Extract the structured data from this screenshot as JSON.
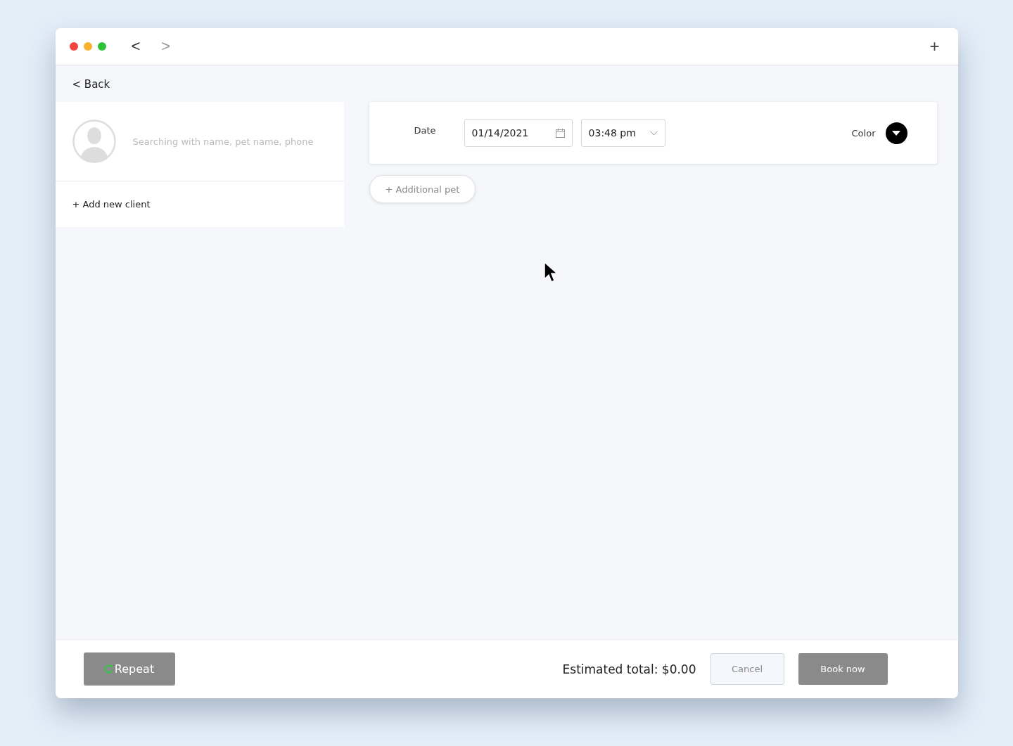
{
  "toolbar": {
    "back_arrow": "<",
    "forward_arrow": ">",
    "plus": "+"
  },
  "back_link": "< Back",
  "client": {
    "search_placeholder": "Searching with name, pet name, phone",
    "add_client": "+ Add new client"
  },
  "appointment": {
    "date_label": "Date",
    "date_value": "01/14/2021",
    "time_value": "03:48 pm",
    "color_label": "Color"
  },
  "additional_pet": "+ Additional pet",
  "footer": {
    "repeat": "Repeat",
    "estimated_total": "Estimated total: $0.00",
    "cancel": "Cancel",
    "book_now": "Book now"
  }
}
